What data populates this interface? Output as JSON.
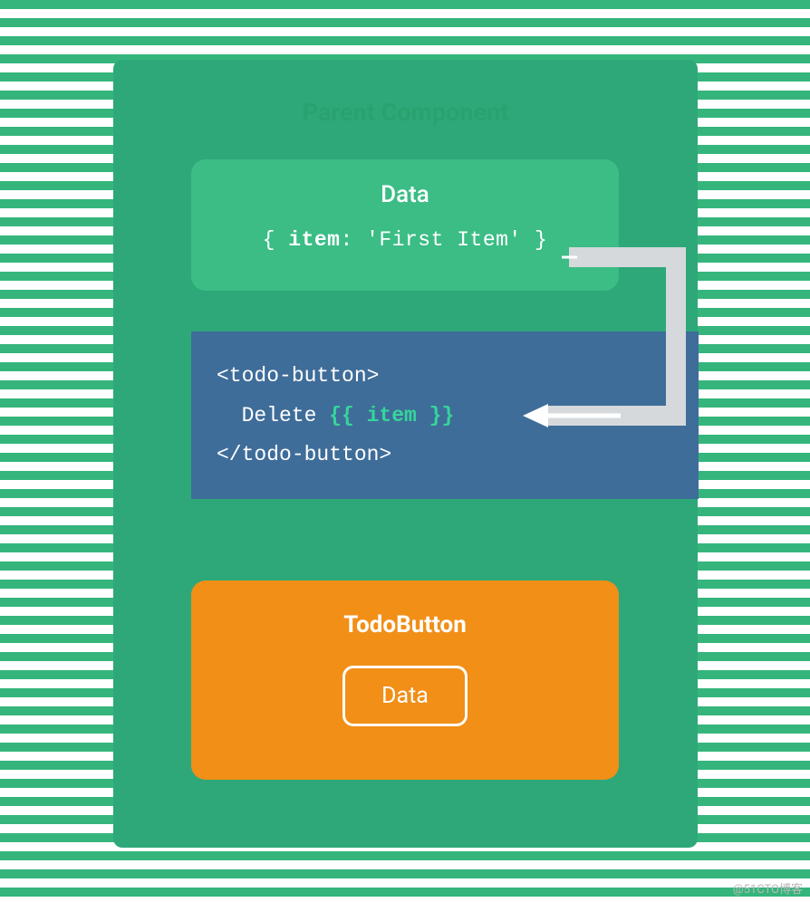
{
  "parent": {
    "title": "Parent Component",
    "data_card": {
      "title": "Data",
      "body_open": "{ ",
      "body_key": "item",
      "body_colon": ": ",
      "body_value": "'First Item'",
      "body_close": " }"
    },
    "code": {
      "line1": "<todo-button>",
      "line2_prefix": "Delete ",
      "line2_expr": "{{ item }}",
      "line3": "</todo-button>"
    }
  },
  "child": {
    "title": "TodoButton",
    "data_label": "Data"
  },
  "watermark": "@51CTO博客"
}
